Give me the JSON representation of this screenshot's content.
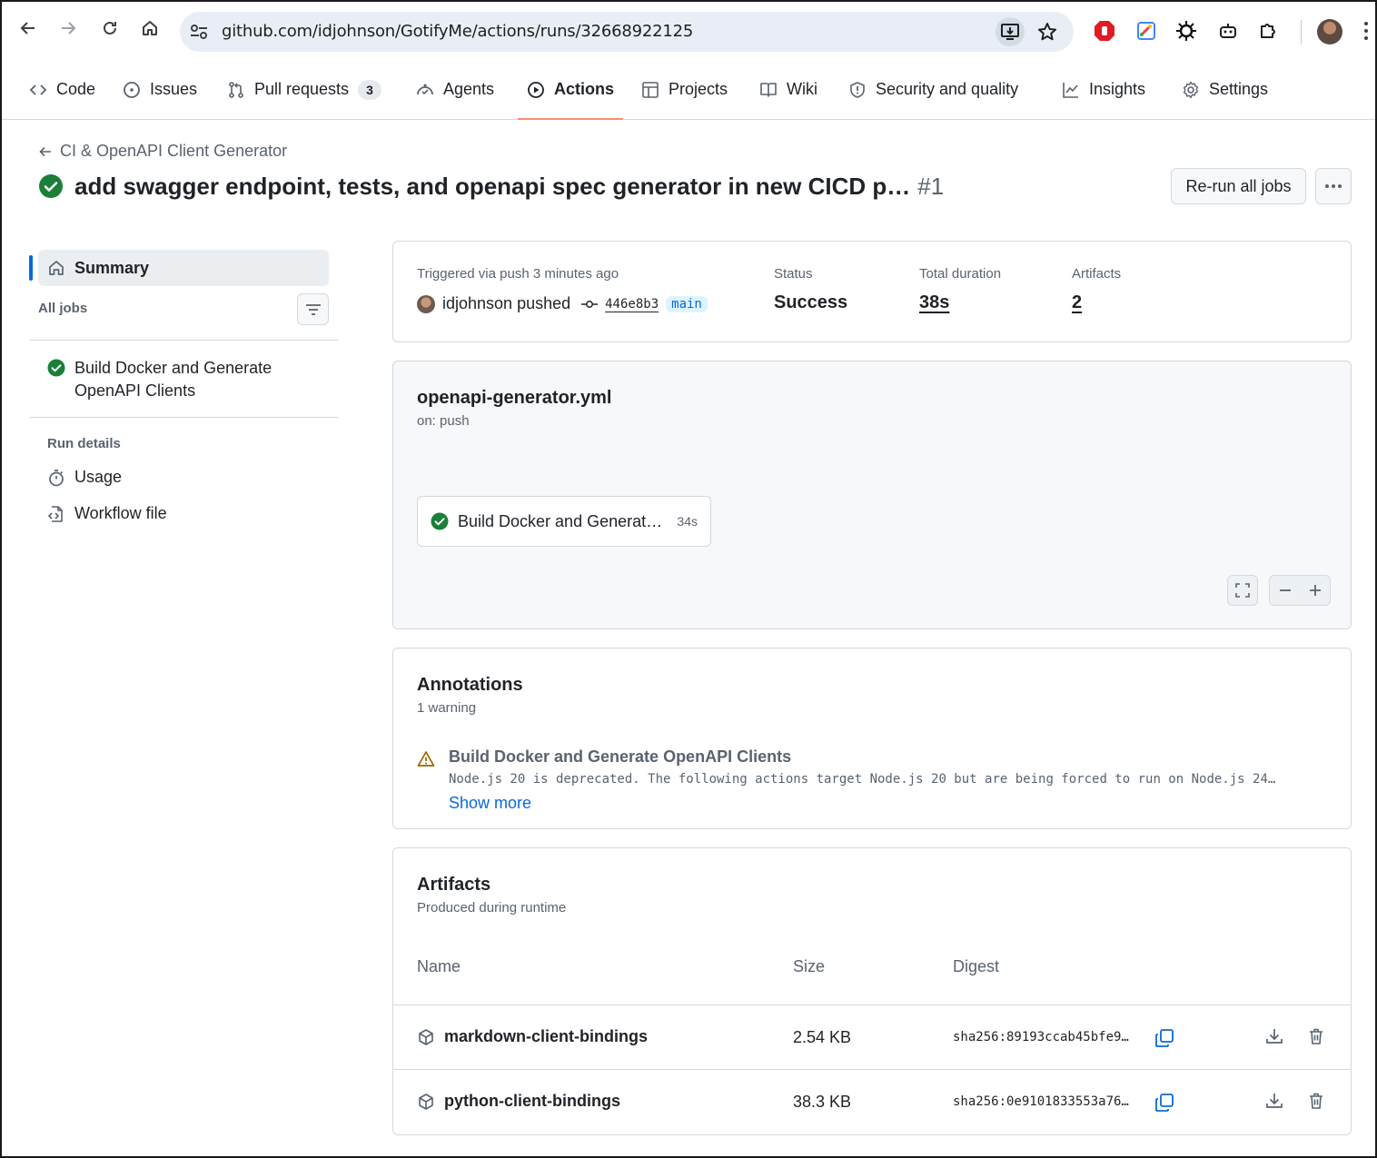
{
  "browser": {
    "url": "github.com/idjohnson/GotifyMe/actions/runs/32668922125"
  },
  "repo_nav": {
    "tabs": [
      {
        "label": "Code"
      },
      {
        "label": "Issues"
      },
      {
        "label": "Pull requests",
        "count": "3"
      },
      {
        "label": "Agents"
      },
      {
        "label": "Actions"
      },
      {
        "label": "Projects"
      },
      {
        "label": "Wiki"
      },
      {
        "label": "Security and quality"
      },
      {
        "label": "Insights"
      },
      {
        "label": "Settings"
      }
    ]
  },
  "header": {
    "back_label": "CI & OpenAPI Client Generator",
    "title": "add swagger endpoint, tests, and openapi spec generator in new CICD p…",
    "run_number": "#1",
    "rerun_label": "Re-run all jobs"
  },
  "sidebar": {
    "summary_label": "Summary",
    "all_jobs_label": "All jobs",
    "job_line1": "Build Docker and Generate",
    "job_line2": "OpenAPI Clients",
    "run_details_label": "Run details",
    "usage_label": "Usage",
    "workflow_file_label": "Workflow file"
  },
  "summary_card": {
    "triggered_label": "Triggered via push 3 minutes ago",
    "actor": "idjohnson pushed",
    "commit": "446e8b3",
    "branch": "main",
    "status_label": "Status",
    "status_value": "Success",
    "duration_label": "Total duration",
    "duration_value": "38s",
    "artifacts_label": "Artifacts",
    "artifacts_value": "2"
  },
  "workflow_card": {
    "file": "openapi-generator.yml",
    "trigger": "on: push",
    "job_name": "Build Docker and Generat…",
    "job_duration": "34s"
  },
  "annotations": {
    "title": "Annotations",
    "subtitle": "1 warning",
    "item_title": "Build Docker and Generate OpenAPI Clients",
    "item_message": "Node.js 20 is deprecated. The following actions target Node.js 20 but are being forced to run on Node.js 24…",
    "show_more": "Show more"
  },
  "artifacts": {
    "title": "Artifacts",
    "subtitle": "Produced during runtime",
    "col_name": "Name",
    "col_size": "Size",
    "col_digest": "Digest",
    "rows": [
      {
        "name": "markdown-client-bindings",
        "size": "2.54 KB",
        "digest": "sha256:89193ccab45bfe9…"
      },
      {
        "name": "python-client-bindings",
        "size": "38.3 KB",
        "digest": "sha256:0e9101833553a76…"
      }
    ]
  },
  "colors": {
    "success": "#1a7f37",
    "accent": "#0969da",
    "active_tab": "#fd8c73",
    "warning": "#9a6700"
  }
}
